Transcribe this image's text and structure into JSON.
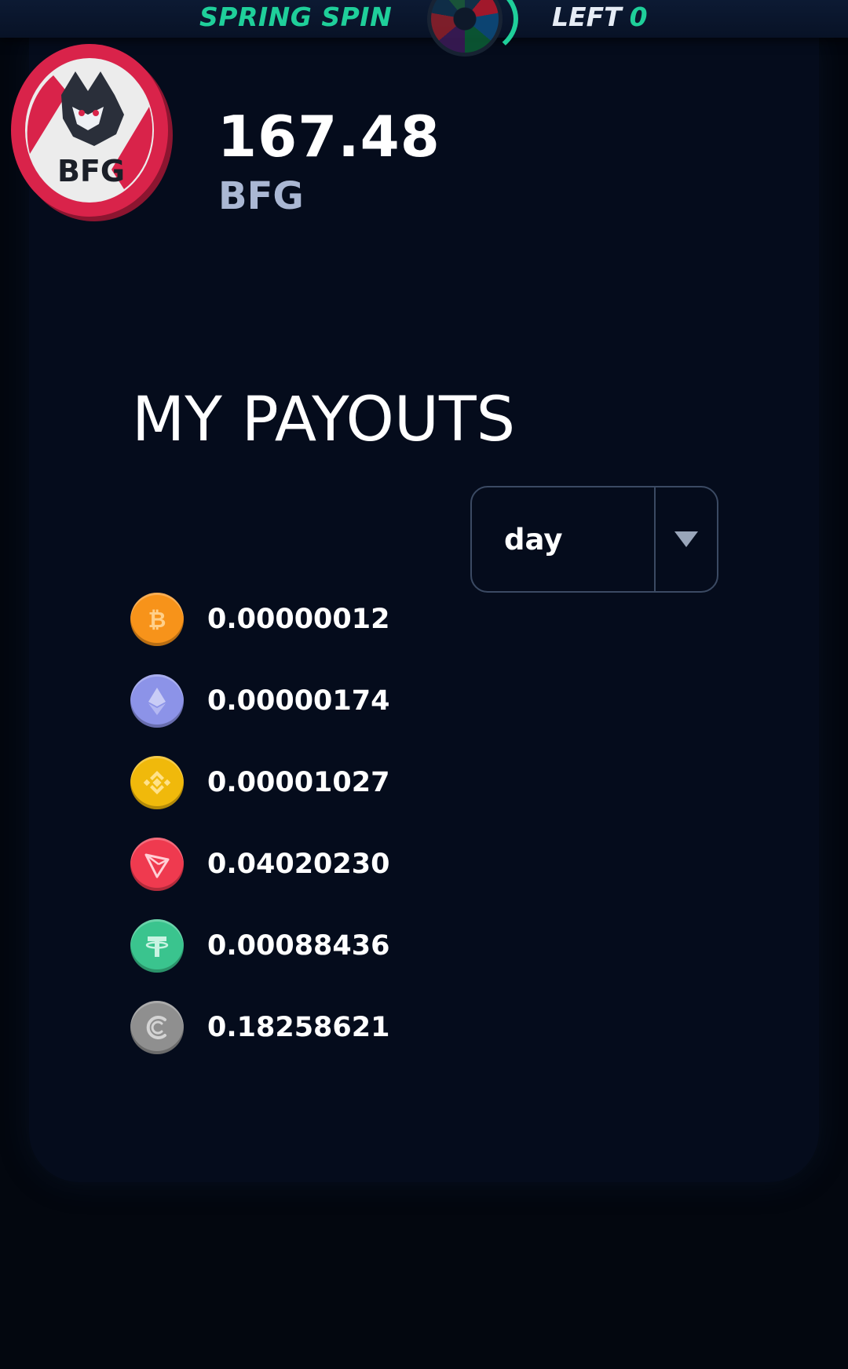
{
  "header": {
    "promo_title": "SPRING SPIN",
    "left_label": "LEFT",
    "left_count": "0"
  },
  "balance": {
    "value": "167.48",
    "ticker": "BFG",
    "logo_text": "BFG"
  },
  "payouts": {
    "title": "MY PAYOUTS",
    "period": "day",
    "items": [
      {
        "coin": "bitcoin-icon",
        "color": "#f7931a",
        "amount": "0.00000012"
      },
      {
        "coin": "ethereum-icon",
        "color": "#8c93e8",
        "amount": "0.00000174"
      },
      {
        "coin": "bnb-icon",
        "color": "#f0b90b",
        "amount": "0.00001027"
      },
      {
        "coin": "tron-icon",
        "color": "#ef3a4f",
        "amount": "0.04020230"
      },
      {
        "coin": "tether-icon",
        "color": "#3ac48e",
        "amount": "0.00088436"
      },
      {
        "coin": "coin-c-icon",
        "color": "#8f8f8f",
        "amount": "0.18258621"
      }
    ]
  }
}
